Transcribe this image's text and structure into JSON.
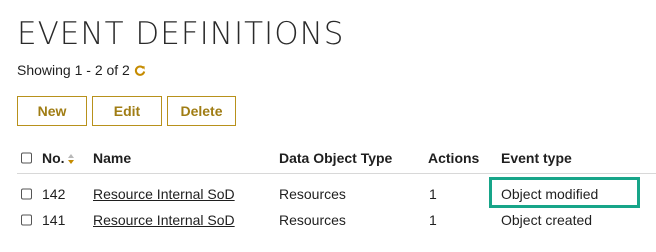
{
  "page": {
    "title": "EVENT DEFINITIONS",
    "showing": "Showing 1 - 2 of 2",
    "refresh_icon": "refresh-icon"
  },
  "toolbar": {
    "new_label": "New",
    "edit_label": "Edit",
    "delete_label": "Delete"
  },
  "table": {
    "columns": {
      "no": "No.",
      "name": "Name",
      "data_object_type": "Data Object Type",
      "actions": "Actions",
      "event_type": "Event type"
    },
    "rows": [
      {
        "no": "142",
        "name": "Resource Internal SoD",
        "data_object_type": "Resources",
        "actions": "1",
        "event_type": "Object modified",
        "highlighted": true
      },
      {
        "no": "141",
        "name": "Resource Internal SoD",
        "data_object_type": "Resources",
        "actions": "1",
        "event_type": "Object created",
        "highlighted": false
      }
    ]
  },
  "colors": {
    "accent": "#b8911b",
    "refresh": "#c58b00",
    "highlight": "#17a589"
  }
}
